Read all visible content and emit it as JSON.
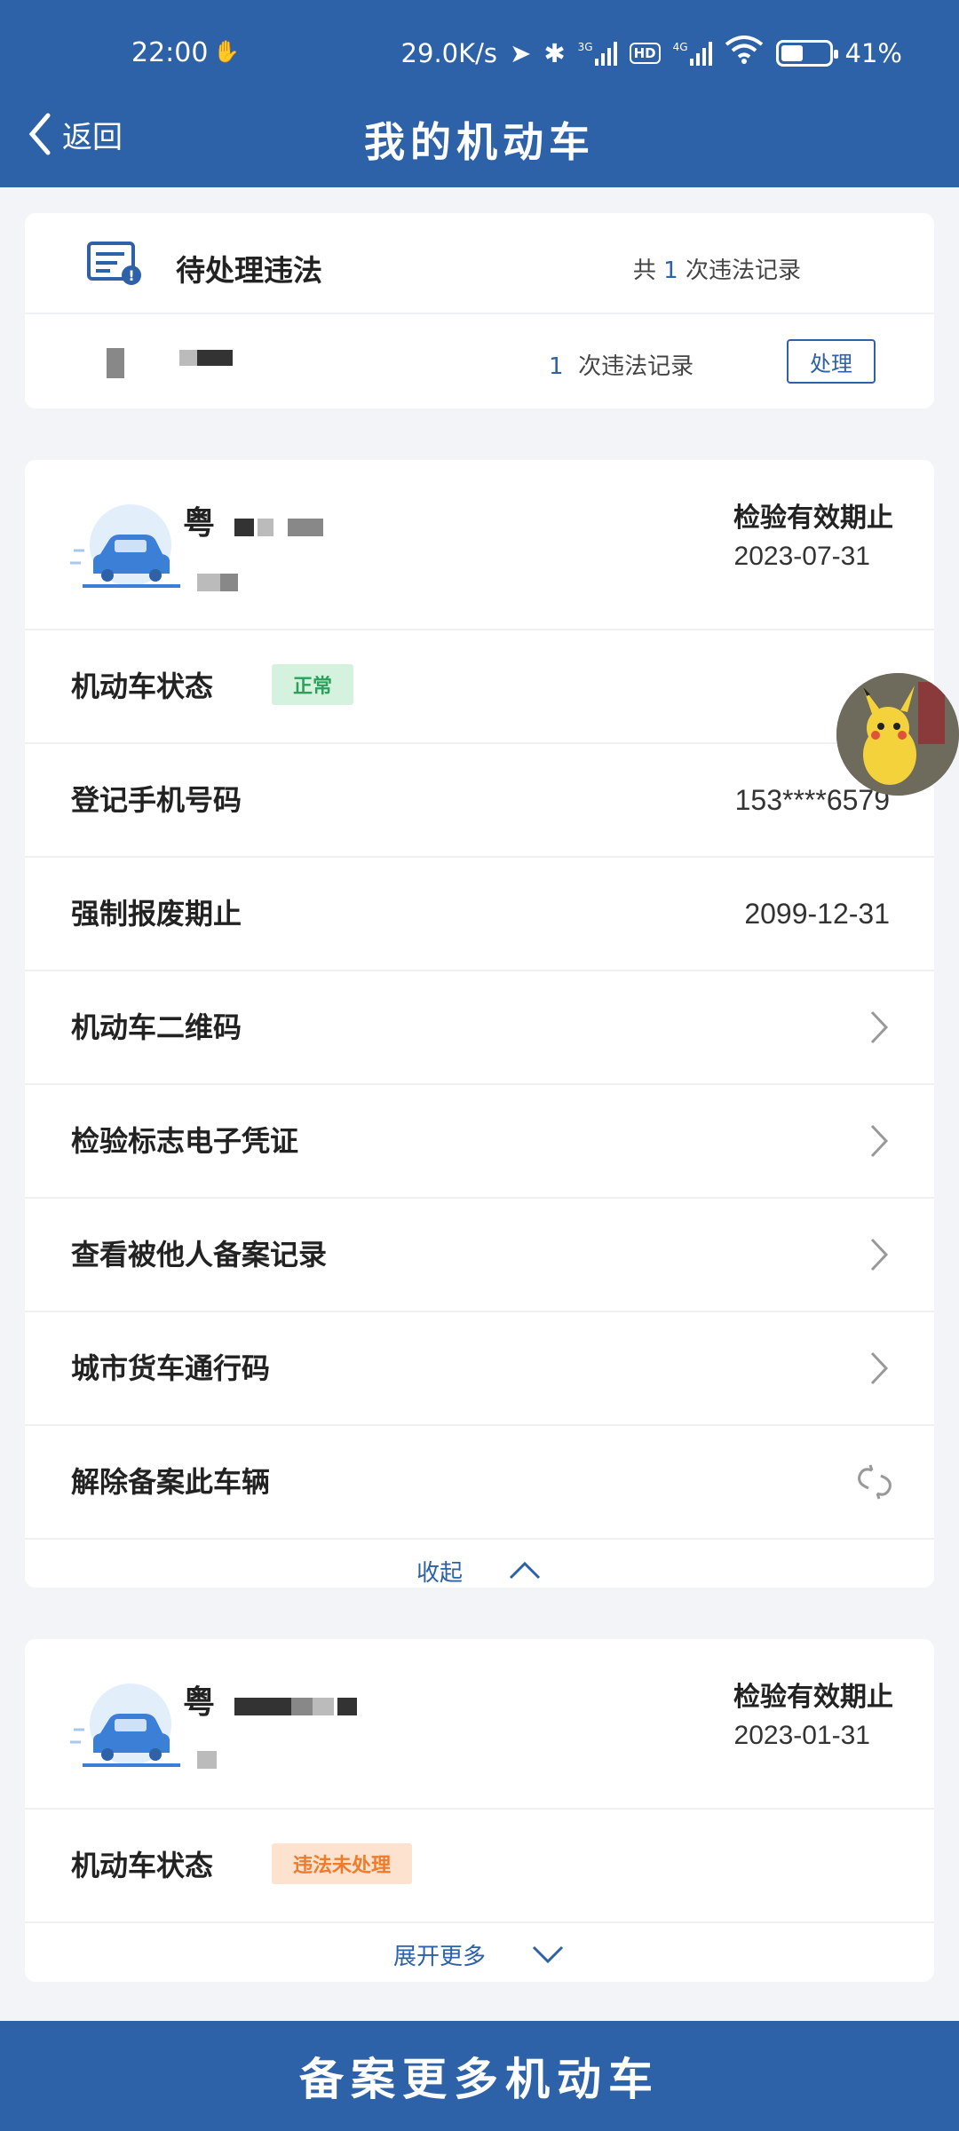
{
  "status_bar": {
    "time": "22:00",
    "network_speed": "29.0K/s",
    "battery": "41%",
    "battery_level": 0.41,
    "sim1": "3G",
    "sim2": "4G",
    "hd": "HD"
  },
  "nav": {
    "back_label": "返回",
    "title": "我的机动车"
  },
  "violations": {
    "title": "待处理违法",
    "total_prefix": "共",
    "total_count": "1",
    "total_suffix": "次违法记录",
    "row_count": "1",
    "row_suffix": "次违法记录",
    "handle_button": "处理"
  },
  "vehicles": [
    {
      "plate_prefix": "粤",
      "inspection_label": "检验有效期止",
      "inspection_date": "2023-07-31",
      "rows": [
        {
          "label": "机动车状态",
          "status": "正常"
        },
        {
          "label": "登记手机号码",
          "value": "153****6579"
        },
        {
          "label": "强制报废期止",
          "value": "2099-12-31"
        },
        {
          "label": "机动车二维码"
        },
        {
          "label": "检验标志电子凭证"
        },
        {
          "label": "查看被他人备案记录"
        },
        {
          "label": "城市货车通行码"
        },
        {
          "label": "解除备案此车辆"
        }
      ],
      "toggle_label": "收起"
    },
    {
      "plate_prefix": "粤",
      "inspection_label": "检验有效期止",
      "inspection_date": "2023-01-31",
      "rows": [
        {
          "label": "机动车状态",
          "status": "违法未处理"
        }
      ],
      "toggle_label": "展开更多"
    }
  ],
  "bottom_button": "备案更多机动车",
  "colors": {
    "primary": "#2d61a8",
    "status_ok_bg": "#d4f2dd",
    "status_ok_text": "#2aa05a",
    "status_warn_bg": "#fde2cf",
    "status_warn_text": "#f07b2a"
  }
}
